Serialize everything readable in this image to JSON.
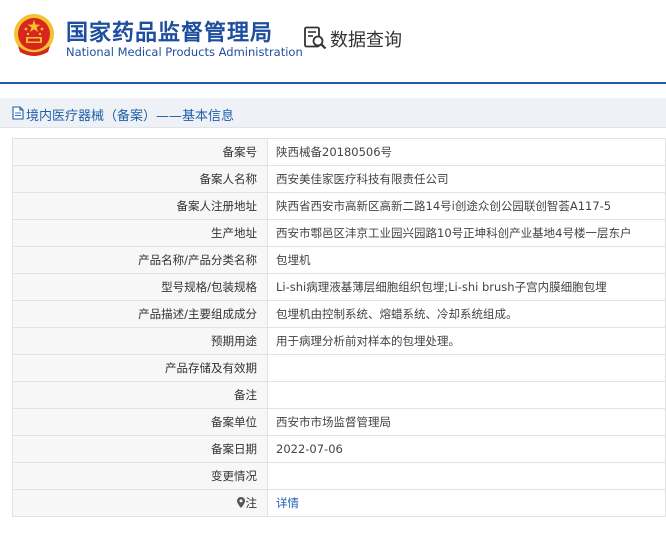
{
  "header": {
    "brand_cn": "国家药品监督管理局",
    "brand_en": "National Medical Products Administration",
    "query_label": "数据查询"
  },
  "breadcrumb": {
    "text": "境内医疗器械（备案）——基本信息"
  },
  "table": {
    "rows": [
      {
        "label": "备案号",
        "value": "陕西械备20180506号"
      },
      {
        "label": "备案人名称",
        "value": "西安美佳家医疗科技有限责任公司"
      },
      {
        "label": "备案人注册地址",
        "value": "陕西省西安市高新区高新二路14号i创途众创公园联创智荟A117-5"
      },
      {
        "label": "生产地址",
        "value": "西安市鄠邑区沣京工业园兴园路10号正坤科创产业基地4号楼一层东户"
      },
      {
        "label": "产品名称/产品分类名称",
        "value": "包埋机"
      },
      {
        "label": "型号规格/包装规格",
        "value": "Li-shi病理液基薄层细胞组织包埋;Li-shi brush子宫内膜细胞包埋"
      },
      {
        "label": "产品描述/主要组成成分",
        "value": "包埋机由控制系统、熔蜡系统、冷却系统组成。"
      },
      {
        "label": "预期用途",
        "value": "用于病理分析前对样本的包埋处理。"
      },
      {
        "label": "产品存储及有效期",
        "value": ""
      },
      {
        "label": "备注",
        "value": ""
      },
      {
        "label": "备案单位",
        "value": "西安市市场监督管理局"
      },
      {
        "label": "备案日期",
        "value": "2022-07-06"
      },
      {
        "label": "变更情况",
        "value": ""
      },
      {
        "label": "注",
        "value": "详情"
      }
    ]
  },
  "colors": {
    "brand_blue": "#1f4e9e",
    "link_blue": "#1a5fb4",
    "header_line": "#1f5fa8",
    "emblem_red": "#d8261e",
    "emblem_gold": "#f2c230"
  }
}
